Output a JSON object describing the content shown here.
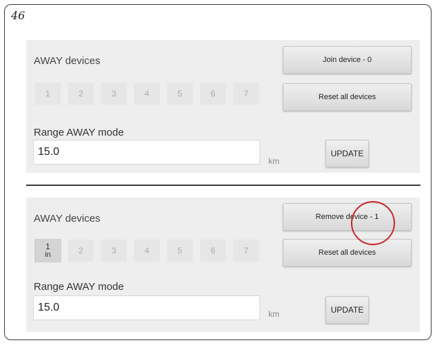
{
  "page_number": "46",
  "panels": [
    {
      "section_title": "AWAY devices",
      "device_slots": [
        {
          "label": "1",
          "sub": "",
          "active": false
        },
        {
          "label": "2",
          "sub": "",
          "active": false
        },
        {
          "label": "3",
          "sub": "",
          "active": false
        },
        {
          "label": "4",
          "sub": "",
          "active": false
        },
        {
          "label": "5",
          "sub": "",
          "active": false
        },
        {
          "label": "6",
          "sub": "",
          "active": false
        },
        {
          "label": "7",
          "sub": "",
          "active": false
        }
      ],
      "primary_action_label": "Join device - 0",
      "reset_label": "Reset all devices",
      "range_label": "Range AWAY mode",
      "range_value": "15.0",
      "unit": "km",
      "update_label": "UPDATE"
    },
    {
      "section_title": "AWAY devices",
      "device_slots": [
        {
          "label": "1",
          "sub": "in",
          "active": true
        },
        {
          "label": "2",
          "sub": "",
          "active": false
        },
        {
          "label": "3",
          "sub": "",
          "active": false
        },
        {
          "label": "4",
          "sub": "",
          "active": false
        },
        {
          "label": "5",
          "sub": "",
          "active": false
        },
        {
          "label": "6",
          "sub": "",
          "active": false
        },
        {
          "label": "7",
          "sub": "",
          "active": false
        }
      ],
      "primary_action_label": "Remove device - 1",
      "reset_label": "Reset all devices",
      "range_label": "Range AWAY mode",
      "range_value": "15.0",
      "unit": "km",
      "update_label": "UPDATE"
    }
  ],
  "colors": {
    "panel_bg": "#eeeeee",
    "highlight": "#c8242a",
    "frame_border": "#3a3a3a"
  }
}
